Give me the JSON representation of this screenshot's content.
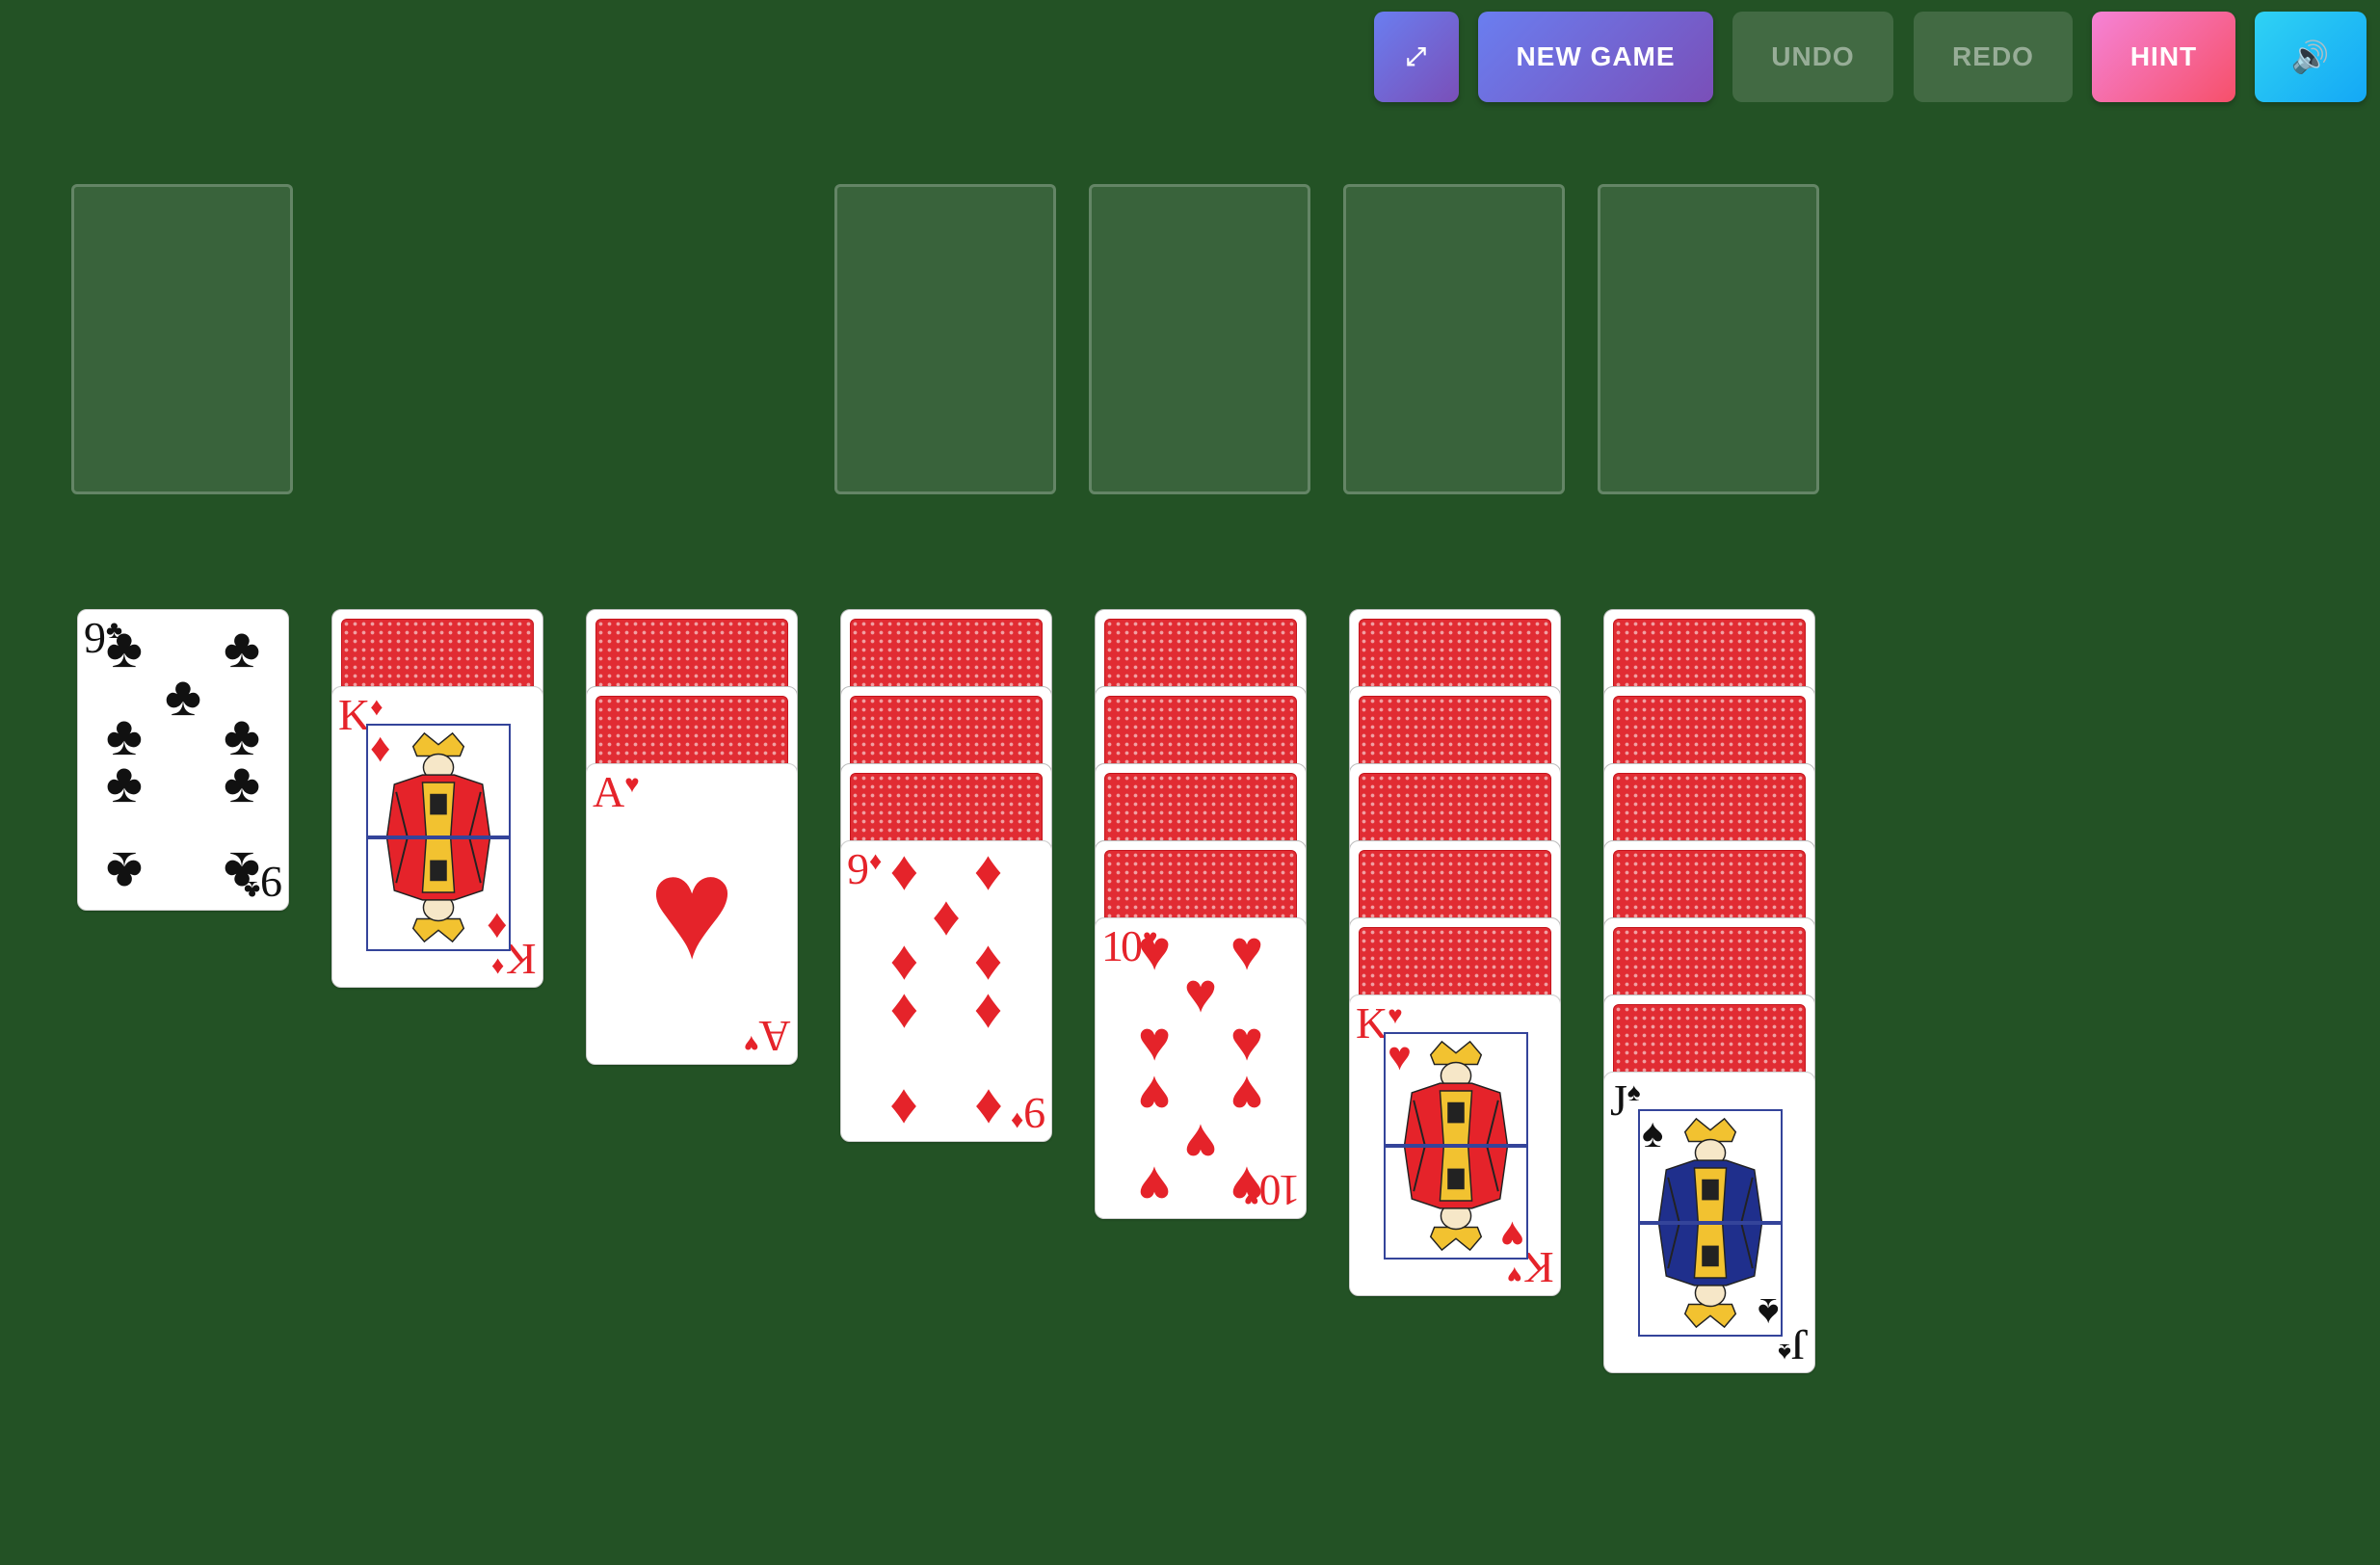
{
  "toolbar": {
    "fullscreen_label": "⤢",
    "new_game_label": "NEW GAME",
    "undo_label": "UNDO",
    "redo_label": "REDO",
    "hint_label": "HINT",
    "sound_label": "🔊"
  },
  "colors": {
    "table": "#235225",
    "card_red": "#e5232a",
    "card_black": "#111111",
    "card_back": "#e12c33",
    "new_game_gradient": [
      "#6a7ef0",
      "#7a4fb8"
    ],
    "hint_gradient": [
      "#f583d6",
      "#f6506a"
    ],
    "sound_gradient": [
      "#2fd2f4",
      "#14a8f5"
    ]
  },
  "tableau": [
    {
      "hidden": 0,
      "cards": [
        {
          "rank": "9",
          "suit": "♣",
          "color": "black"
        }
      ]
    },
    {
      "hidden": 1,
      "cards": [
        {
          "rank": "K",
          "suit": "♦",
          "color": "red"
        }
      ]
    },
    {
      "hidden": 2,
      "cards": [
        {
          "rank": "A",
          "suit": "♥",
          "color": "red"
        }
      ]
    },
    {
      "hidden": 3,
      "cards": [
        {
          "rank": "9",
          "suit": "♦",
          "color": "red"
        }
      ]
    },
    {
      "hidden": 4,
      "cards": [
        {
          "rank": "10",
          "suit": "♥",
          "color": "red"
        }
      ]
    },
    {
      "hidden": 5,
      "cards": [
        {
          "rank": "K",
          "suit": "♥",
          "color": "red"
        }
      ]
    },
    {
      "hidden": 6,
      "cards": [
        {
          "rank": "J",
          "suit": "♠",
          "color": "black"
        }
      ]
    }
  ]
}
